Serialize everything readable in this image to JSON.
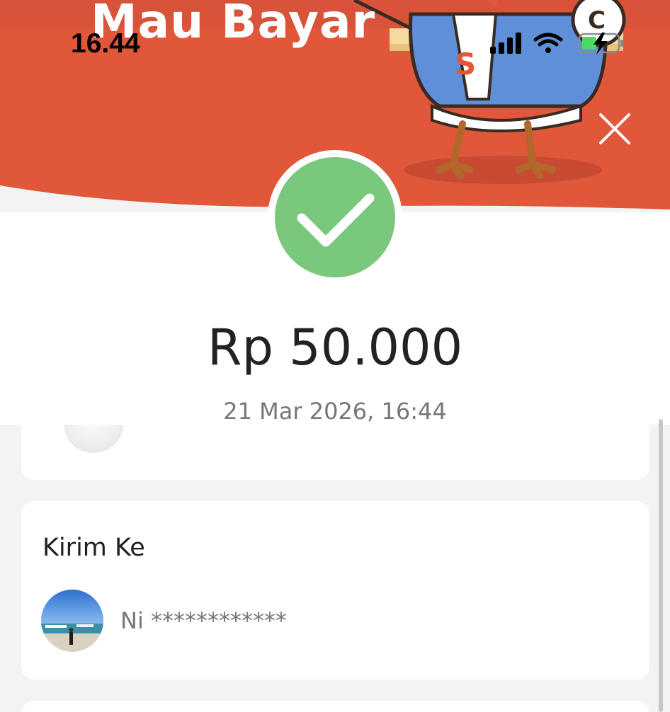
{
  "status_bar": {
    "time": "16.44",
    "icons": [
      "signal-icon",
      "wifi-icon",
      "battery-charging-icon"
    ]
  },
  "banner": {
    "title": "Mau Bayar",
    "mascot_icon": "chicken-mascot-icon",
    "mascot_letters": [
      "S",
      "C"
    ],
    "close_icon": "close-icon"
  },
  "payment": {
    "status_icon": "check-icon",
    "amount": "Rp 50.000",
    "datetime": "21 Mar 2026, 16:44"
  },
  "recipient_card": {
    "title": "Kirim Ke",
    "name": "Ni ************"
  },
  "colors": {
    "banner": "#e0573a",
    "success": "#79c87b",
    "page_bg": "#f3f3f3",
    "card_bg": "#ffffff"
  }
}
